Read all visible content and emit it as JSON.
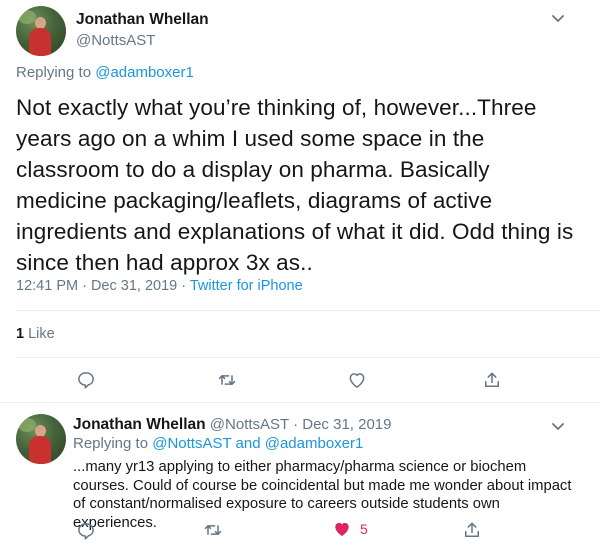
{
  "main_tweet": {
    "author_name": "Jonathan Whellan",
    "author_handle": "@NottsAST",
    "replying_label": "Replying to ",
    "replying_to": "@adamboxer1",
    "text": "Not exactly what you’re thinking of, however...Three years ago on a whim I used some space in the classroom to do a display on pharma. Basically medicine packaging/leaflets, diagrams of active ingredients and explanations of what it did. Odd thing is since then had approx 3x as..",
    "time": "12:41 PM · Dec 31, 2019 · ",
    "source": "Twitter for iPhone",
    "like_count": "1",
    "like_label": " Like"
  },
  "reply_tweet": {
    "author_name": "Jonathan Whellan",
    "author_meta": " @NottsAST · Dec 31, 2019",
    "replying_label": "Replying to ",
    "replying_to_1": "@NottsAST",
    "replying_and": " and ",
    "replying_to_2": "@adamboxer1",
    "text": "...many yr13 applying to either pharmacy/pharma science or biochem courses. Could of course be coincidental but made me wonder about impact of constant/normalised exposure to careers outside students own experiences.",
    "like_count": "5"
  },
  "icons": {
    "more": "chevron-down-icon",
    "reply": "speech-bubble-icon",
    "retweet": "retweet-icon",
    "like": "heart-icon",
    "share": "share-icon"
  },
  "colors": {
    "link": "#1b95e0",
    "muted": "#657786",
    "like_active": "#e0245e"
  }
}
